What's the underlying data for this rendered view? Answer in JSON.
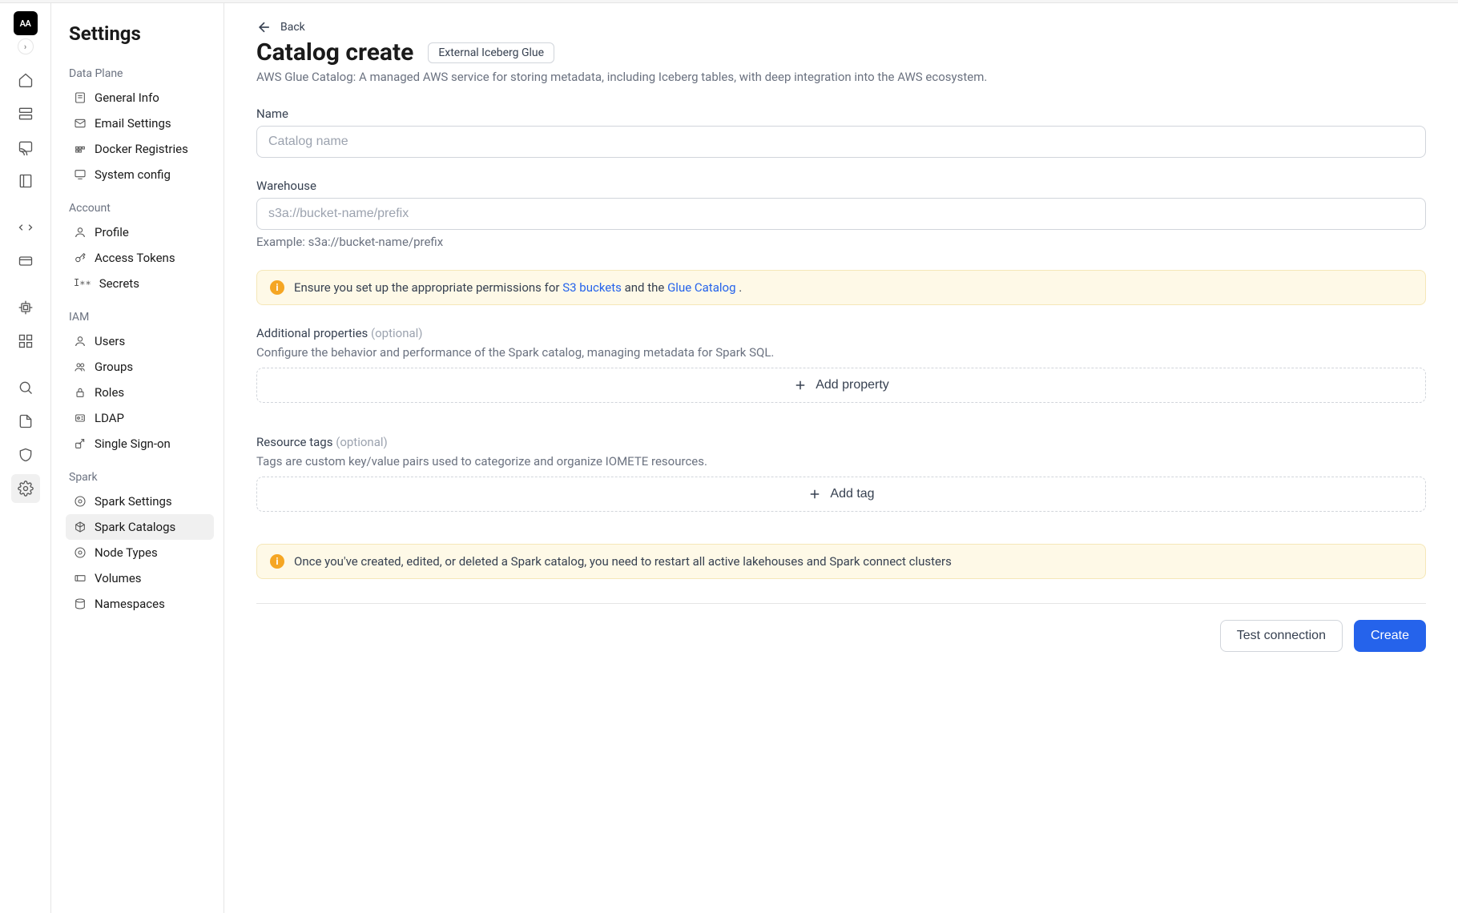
{
  "rail": {
    "logo": "AA"
  },
  "settings": {
    "title": "Settings",
    "sections": {
      "data_plane": {
        "label": "Data Plane",
        "items": [
          "General Info",
          "Email Settings",
          "Docker Registries",
          "System config"
        ]
      },
      "account": {
        "label": "Account",
        "items": [
          "Profile",
          "Access Tokens",
          "Secrets"
        ]
      },
      "iam": {
        "label": "IAM",
        "items": [
          "Users",
          "Groups",
          "Roles",
          "LDAP",
          "Single Sign-on"
        ]
      },
      "spark": {
        "label": "Spark",
        "items": [
          "Spark Settings",
          "Spark Catalogs",
          "Node Types",
          "Volumes",
          "Namespaces"
        ]
      }
    }
  },
  "page": {
    "back": "Back",
    "title": "Catalog create",
    "badge": "External Iceberg Glue",
    "desc": "AWS Glue Catalog: A managed AWS service for storing metadata, including Iceberg tables, with deep integration into the AWS ecosystem."
  },
  "form": {
    "name": {
      "label": "Name",
      "placeholder": "Catalog name"
    },
    "warehouse": {
      "label": "Warehouse",
      "placeholder": "s3a://bucket-name/prefix",
      "help": "Example: s3a://bucket-name/prefix"
    },
    "alert1": {
      "before": "Ensure you set up the appropriate permissions for ",
      "link1": "S3 buckets",
      "mid": " and the ",
      "link2": "Glue Catalog",
      "after": " ."
    },
    "props": {
      "label": "Additional properties ",
      "opt": "(optional)",
      "desc": "Configure the behavior and performance of the Spark catalog, managing metadata for Spark SQL.",
      "btn": "Add property"
    },
    "tags": {
      "label": "Resource tags ",
      "opt": "(optional)",
      "desc": "Tags are custom key/value pairs used to categorize and organize IOMETE resources.",
      "btn": "Add tag"
    },
    "alert2": "Once you've created, edited, or deleted a Spark catalog, you need to restart all active lakehouses and Spark connect clusters"
  },
  "actions": {
    "test": "Test connection",
    "create": "Create"
  }
}
